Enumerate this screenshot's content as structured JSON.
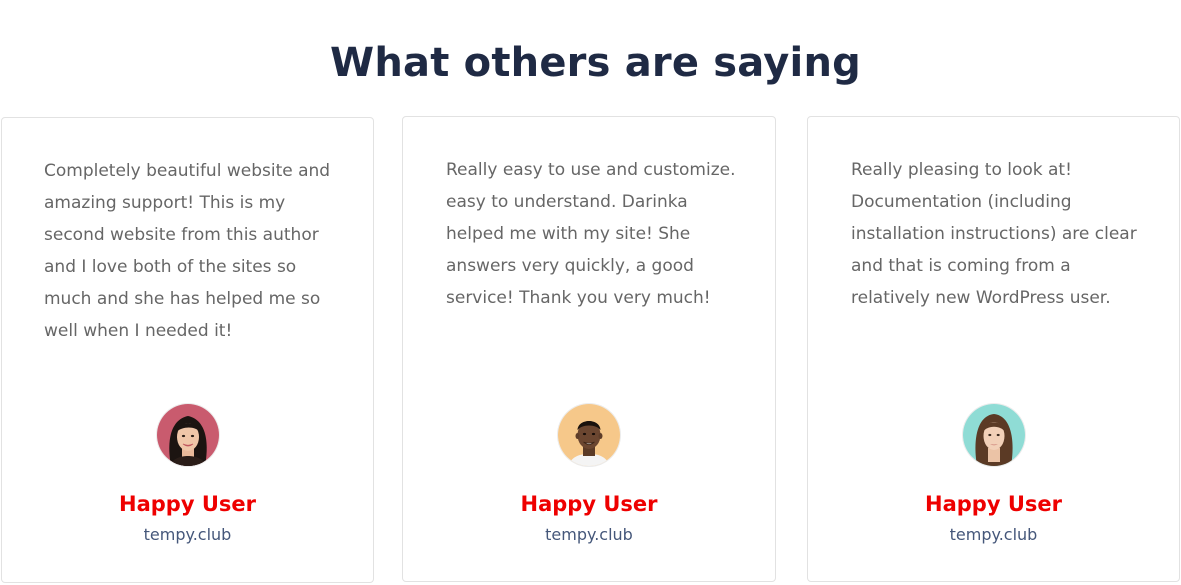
{
  "section": {
    "title": "What others are saying"
  },
  "testimonials": [
    {
      "quote": "Completely beautiful website and amazing support! This is my second website from this author and I love both of the sites so much and she has helped me so well when I needed it!",
      "author": "Happy User",
      "site": "tempy.club",
      "avatar_bg": "#c95b6e"
    },
    {
      "quote": "Really easy to use and customize. easy to understand. Darinka helped me with my site! She answers very quickly, a good service! Thank you very much!",
      "author": "Happy User",
      "site": "tempy.club",
      "avatar_bg": "#f6c88a"
    },
    {
      "quote": "Really pleasing to look at! Documentation (including installation instructions) are clear and that is coming from a relatively new WordPress user.",
      "author": "Happy User",
      "site": "tempy.club",
      "avatar_bg": "#8fdcd5"
    }
  ],
  "colors": {
    "heading": "#1f2a44",
    "author": "#ee0000",
    "site": "#45577a",
    "quote_text": "#666666",
    "card_border": "#e2e2e2"
  }
}
